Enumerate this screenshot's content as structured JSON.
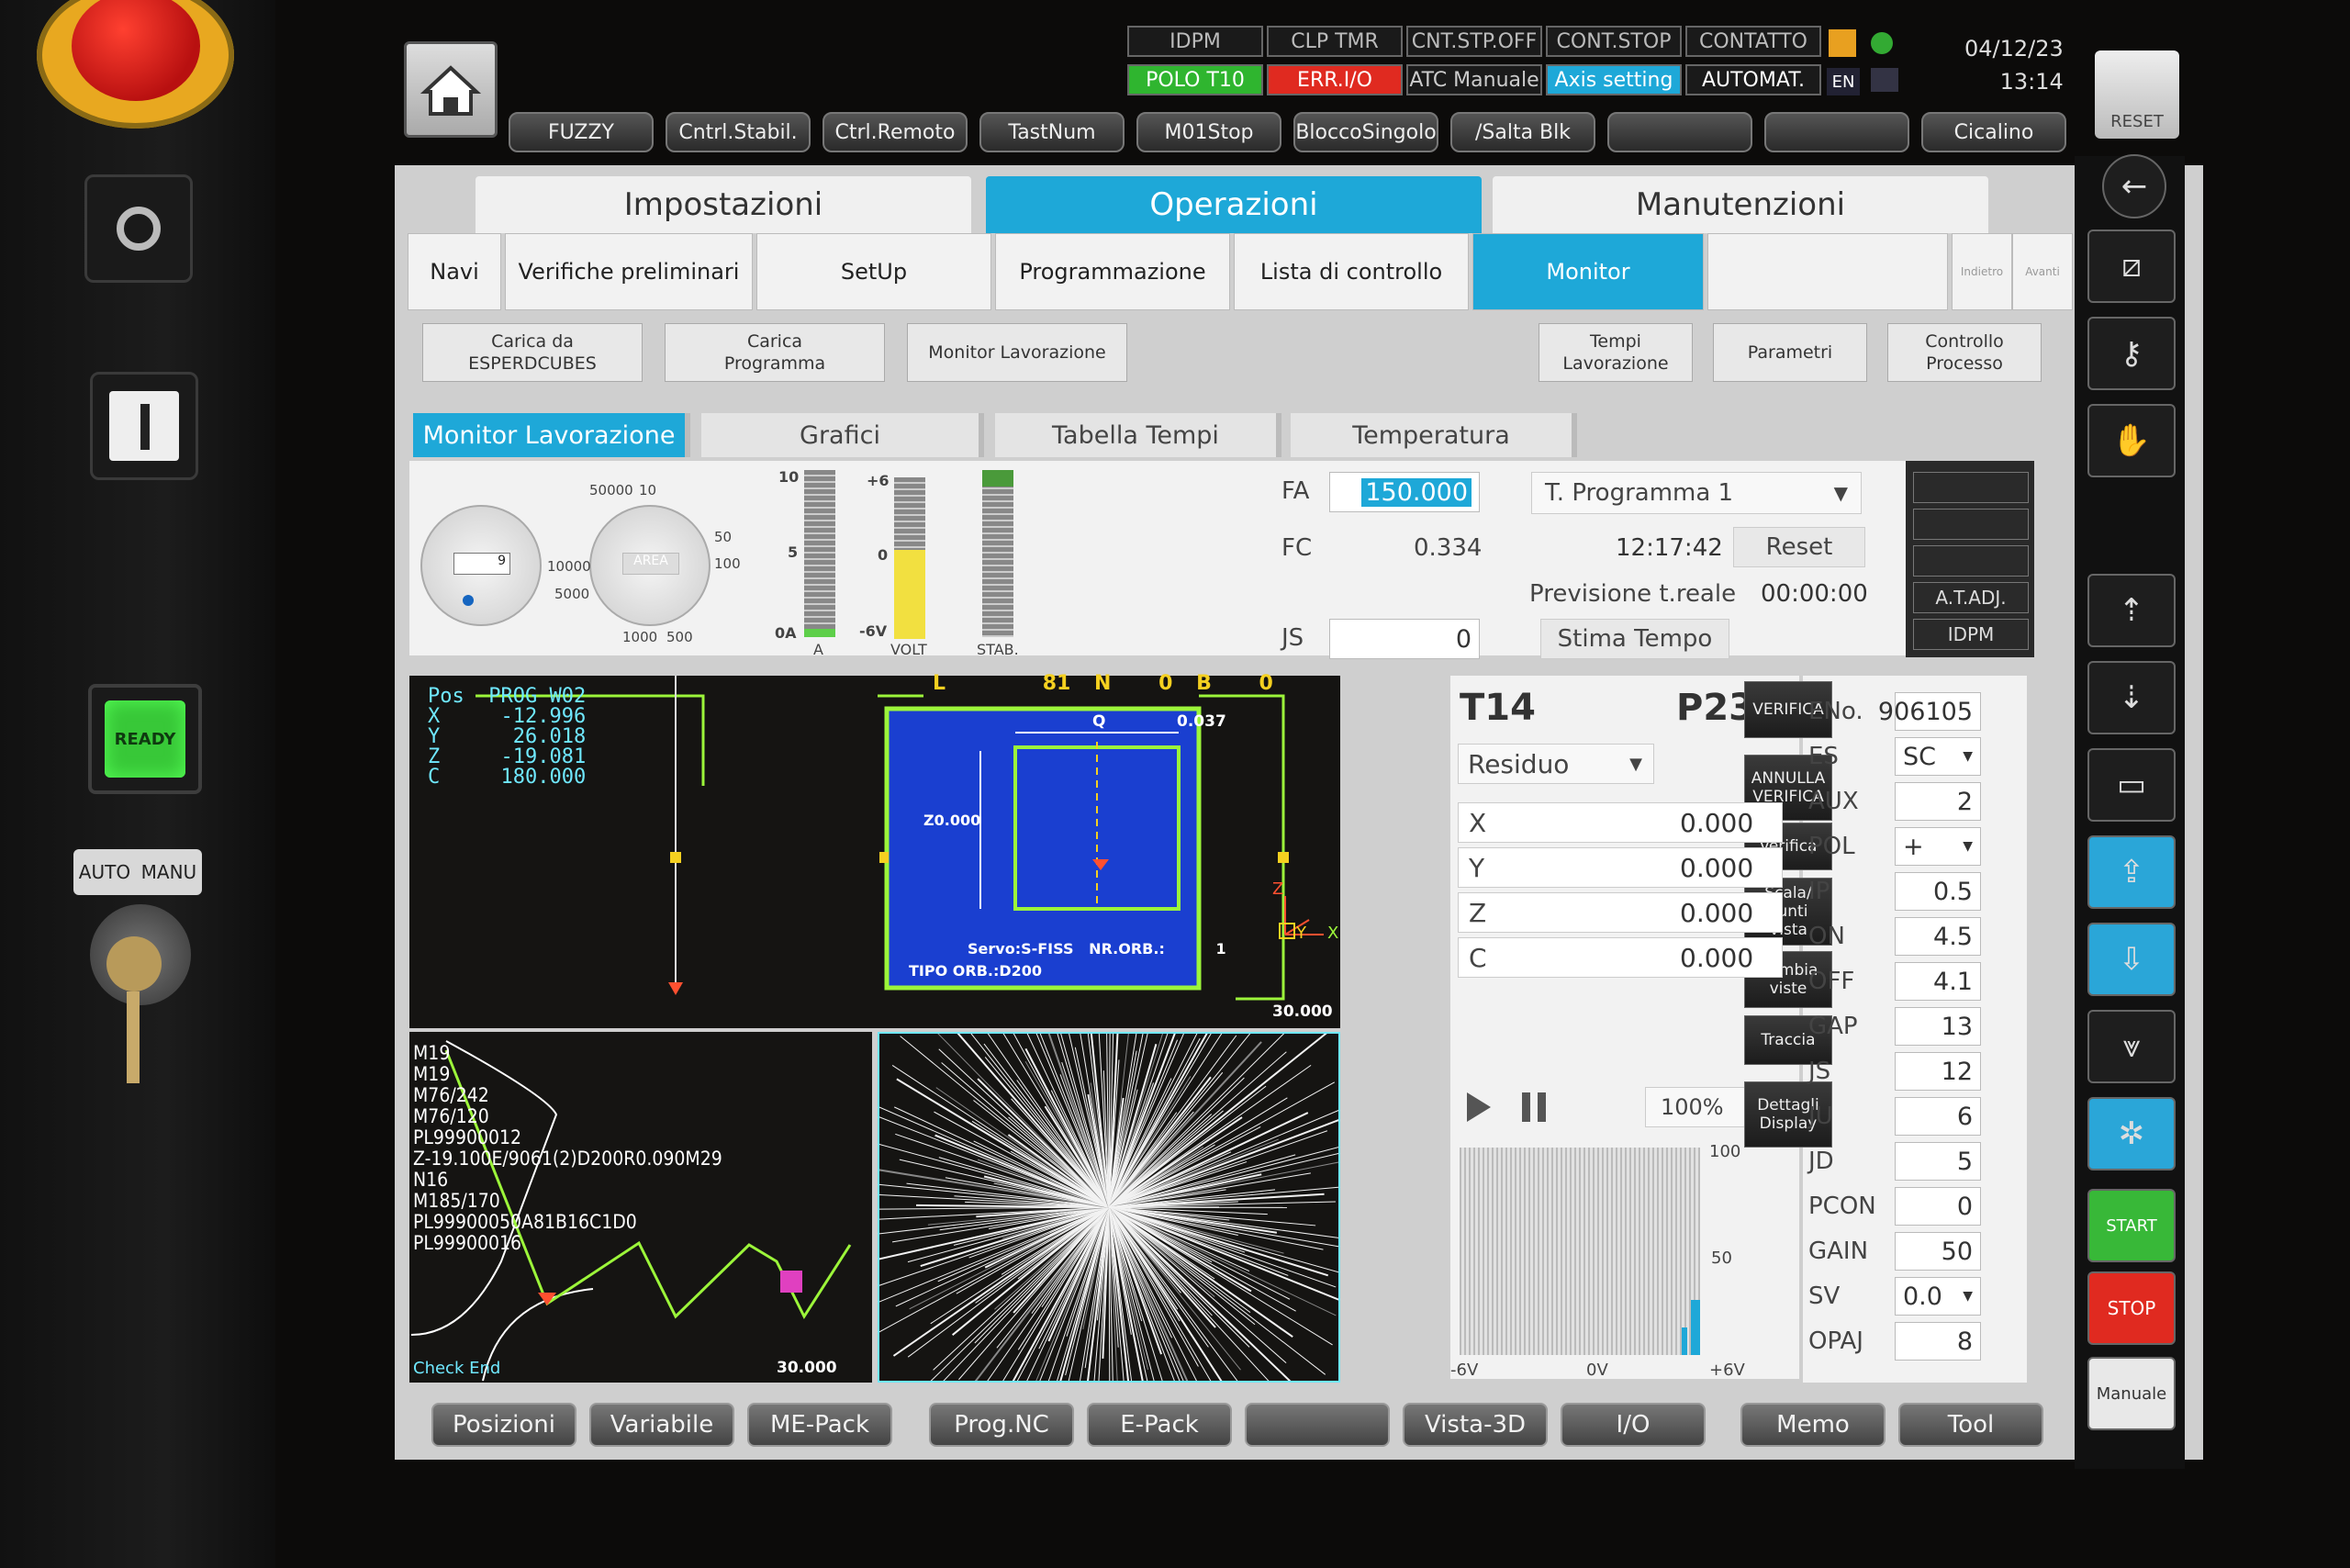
{
  "top_status": {
    "row1": [
      "IDPM",
      "CLP TMR",
      "CNT.STP.OFF",
      "CONT.STOP",
      "CONTATTO"
    ],
    "row2": [
      "POLO T10",
      "ERR.I/O",
      "ATC Manuale",
      "Axis setting",
      "AUTOMAT."
    ],
    "lang": "EN",
    "date": "04/12/23",
    "time": "13:14"
  },
  "function_keys": [
    "FUZZY",
    "Cntrl.Stabil.",
    "Ctrl.Remoto",
    "TastNum",
    "M01Stop",
    "BloccoSingolo",
    "/Salta Blk",
    "",
    "",
    "Cicalino"
  ],
  "reset_label": "RESET",
  "physical": {
    "ready": "READY",
    "auto": "AUTO",
    "manu": "MANU"
  },
  "main_tabs": [
    "Impostazioni",
    "Operazioni",
    "Manutenzioni"
  ],
  "sub_tabs": [
    "Navi",
    "Verifiche preliminari",
    "SetUp",
    "Programmazione",
    "Lista di controllo",
    "Monitor"
  ],
  "nav_small": [
    "Indietro",
    "Avanti"
  ],
  "action_buttons": {
    "carica_esper": "Carica da\nESPERDCUBES",
    "carica_prog": "Carica\nProgramma",
    "monitor_lav": "Monitor Lavorazione",
    "tempi_lav": "Tempi\nLavorazione",
    "parametri": "Parametri",
    "controllo": "Controllo\nProcesso"
  },
  "panel_tabs": [
    "Monitor Lavorazione",
    "Grafici",
    "Tabella Tempi",
    "Temperatura"
  ],
  "gauges": {
    "g1_scale": [
      "50000",
      "10",
      "10000",
      "5000",
      "1000",
      "500"
    ],
    "g1_val": "9",
    "g2_label": "AREA",
    "g2_scale": [
      "50",
      "100"
    ],
    "bar_a": {
      "top": "10",
      "mid": "5",
      "bot": "0A",
      "unit": "A",
      "level": 0.05
    },
    "bar_v": {
      "top": "+6",
      "mid": "0",
      "bot": "-6V",
      "unit": "VOLT",
      "level": 0.55
    },
    "bar_s": {
      "unit": "STAB.",
      "level": 0.1
    }
  },
  "fa": {
    "label": "FA",
    "value": "150.000"
  },
  "fc": {
    "label": "FC",
    "value": "0.334"
  },
  "js": {
    "label": "JS",
    "value": "0"
  },
  "time_panel": {
    "program": "T. Programma 1",
    "clock": "12:17:42",
    "reset": "Reset",
    "prev_label": "Previsione t.reale",
    "prev_value": "00:00:00",
    "stima": "Stima Tempo"
  },
  "right_mini": [
    "",
    "",
    "",
    "A.T.ADJ.",
    "IDPM"
  ],
  "graphic": {
    "header": [
      "L",
      "81",
      "N",
      "0",
      "B",
      "0"
    ],
    "pos_lines": [
      "Pos  PROG W02",
      "X     -12.996",
      "Y      26.018",
      "Z     -19.081",
      "C     180.000"
    ],
    "q_label": "Q",
    "q_val": "0.037",
    "z_val": "Z0.000",
    "servo": "Servo:S-FISS   NR.ORB.:          1",
    "tipo": "TIPO ORB.:D200",
    "scale_val": "30.000",
    "axis": [
      "Z",
      "Y",
      "X"
    ]
  },
  "program_lines": [
    "M19",
    "M19",
    "M76/242",
    "M76/120",
    "PL99900012",
    "Z-19.100E/9061(2)D200R0.090M29",
    "N16",
    "M185/170",
    "PL99900050A81B16C1D0",
    "PL99900016"
  ],
  "program_footer": "Check End",
  "program_scale": "30.000",
  "side_buttons": [
    "VERIFICA",
    "ANNULLA\nVERIFICA",
    "Verifica",
    "Scala/\nPunti\nVista",
    "Cambia\nviste",
    "Traccia",
    "Dettagli\nDisplay"
  ],
  "tool": {
    "t": "T14",
    "p": "P23 #",
    "mode": "Residuo"
  },
  "axes": [
    {
      "name": "X",
      "value": "0.000"
    },
    {
      "name": "Y",
      "value": "0.000"
    },
    {
      "name": "Z",
      "value": "0.000"
    },
    {
      "name": "C",
      "value": "0.000"
    }
  ],
  "playback": {
    "speed": "100%"
  },
  "hist": {
    "y_top": "100",
    "y_mid": "50",
    "x": [
      "-6V",
      "0V",
      "+6V"
    ]
  },
  "params": [
    {
      "name": "ENo.",
      "value": "906105"
    },
    {
      "name": "ES",
      "value": "SC"
    },
    {
      "name": "AUX",
      "value": "2"
    },
    {
      "name": "POL",
      "value": "+"
    },
    {
      "name": "IP",
      "value": "0.5"
    },
    {
      "name": "ON",
      "value": "4.5"
    },
    {
      "name": "OFF",
      "value": "4.1"
    },
    {
      "name": "GAP",
      "value": "13"
    },
    {
      "name": "JS",
      "value": "12"
    },
    {
      "name": "JU",
      "value": "6"
    },
    {
      "name": "JD",
      "value": "5"
    },
    {
      "name": "PCON",
      "value": "0"
    },
    {
      "name": "GAIN",
      "value": "50"
    },
    {
      "name": "SV",
      "value": "0.0"
    },
    {
      "name": "OPAJ",
      "value": "8"
    }
  ],
  "bottom_keys": [
    "Posizioni",
    "Variabile",
    "ME-Pack",
    "Prog.NC",
    "E-Pack",
    "",
    "Vista-3D",
    "I/O",
    "Memo",
    "Tool"
  ],
  "right_icons": {
    "start": "START",
    "stop": "STOP",
    "manual": "Manuale"
  },
  "colors": {
    "accent": "#1ea8d8",
    "graphic_blue": "#1a3fd0",
    "trace_green": "#9cf53a",
    "text_cyan": "#6fe8ff"
  }
}
